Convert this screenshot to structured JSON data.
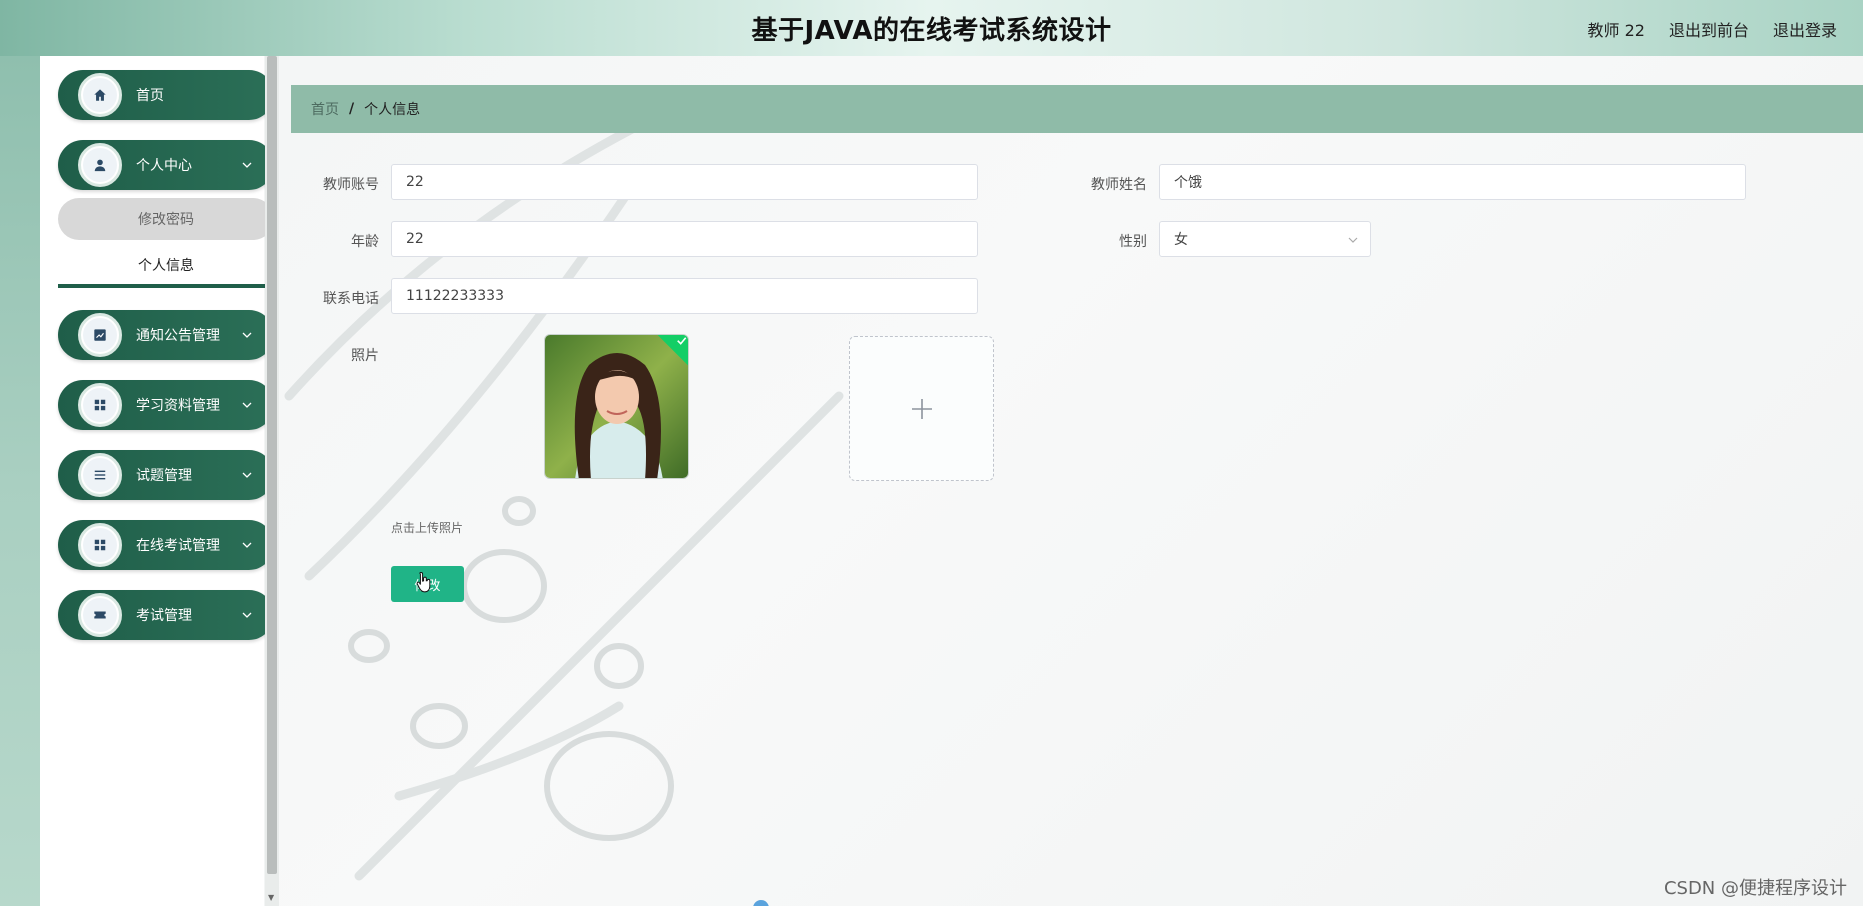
{
  "header": {
    "title": "基于JAVA的在线考试系统设计",
    "user": "教师 22",
    "to_frontend": "退出到前台",
    "logout": "退出登录"
  },
  "sidebar": {
    "items": [
      {
        "label": "首页",
        "icon": "home-icon"
      },
      {
        "label": "个人中心",
        "icon": "user-icon"
      },
      {
        "label": "通知公告管理",
        "icon": "chart-icon"
      },
      {
        "label": "学习资料管理",
        "icon": "grid-icon"
      },
      {
        "label": "试题管理",
        "icon": "list-icon"
      },
      {
        "label": "在线考试管理",
        "icon": "grid-icon"
      },
      {
        "label": "考试管理",
        "icon": "ticket-icon"
      }
    ],
    "submenu": [
      {
        "label": "修改密码"
      },
      {
        "label": "个人信息"
      }
    ]
  },
  "breadcrumb": {
    "home": "首页",
    "separator": "/",
    "current": "个人信息"
  },
  "form": {
    "account_label": "教师账号",
    "account_value": "22",
    "name_label": "教师姓名",
    "name_value": "个饿",
    "age_label": "年龄",
    "age_value": "22",
    "gender_label": "性别",
    "gender_value": "女",
    "phone_label": "联系电话",
    "phone_value": "11122233333",
    "photo_label": "照片",
    "upload_tip": "点击上传照片",
    "submit_label": "修改"
  },
  "watermark": "CSDN @便捷程序设计",
  "colors": {
    "sidebar_green": "#1f5e49",
    "breadcrumb_bg": "#8fbba8",
    "button_green": "#20b487",
    "success_green": "#13ce66"
  }
}
